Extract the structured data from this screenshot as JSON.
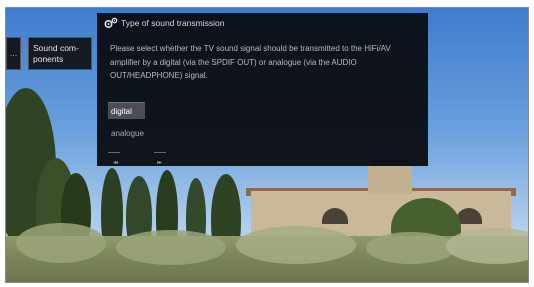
{
  "menu": {
    "side_tab_label": "...",
    "active_tab_label": "Sound com-ponents"
  },
  "dialog": {
    "icon": "gear-icon",
    "title": "Type of sound transmission",
    "message": "Please select whether the TV sound signal should be transmitted to the HiFi/AV amplifier by a digital (via the SPDIF OUT) or analogue (via the AUDIO OUT/HEADPHONE) signal.",
    "options": [
      {
        "label": "digital",
        "selected": true
      },
      {
        "label": "analogue",
        "selected": false
      }
    ],
    "nav": {
      "left_icon": "nav-left-icon",
      "left_glyph": "◂◂",
      "right_icon": "nav-right-icon",
      "right_glyph": "▸▸"
    }
  },
  "colors": {
    "dialog_bg": "#0a0c10",
    "selected_bg": "#4b4f55",
    "sky": "#3f7ccc"
  }
}
